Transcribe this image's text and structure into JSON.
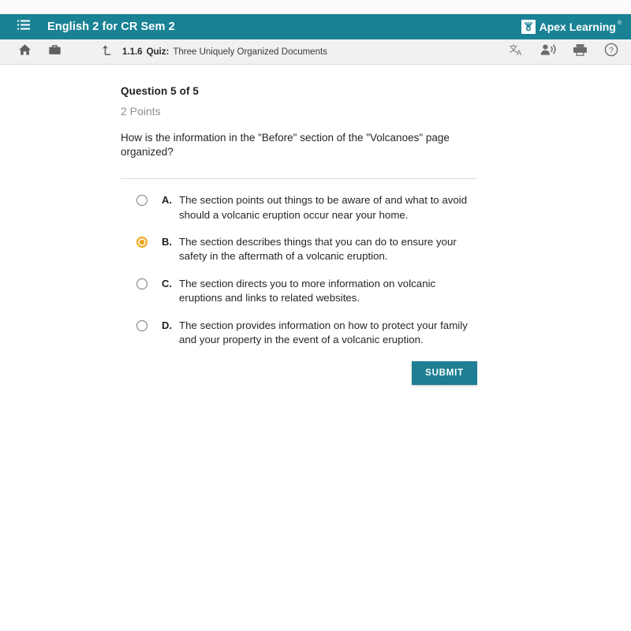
{
  "header": {
    "menu_icon": "list-icon",
    "course_title": "English 2 for CR Sem 2",
    "brand_name": "Apex Learning",
    "brand_tm": "®",
    "brand_logo_icon": "apex-sunburst-logo-icon",
    "accent_color": "#1a8295"
  },
  "subbar": {
    "home_icon": "home-icon",
    "briefcase_icon": "briefcase-icon",
    "up_icon": "arrow-up-from-corner-icon",
    "breadcrumb": {
      "number": "1.1.6",
      "type": "Quiz:",
      "name": "Three Uniquely Organized Documents"
    },
    "translate_icon": "translate-icon",
    "read_aloud_icon": "read-aloud-icon",
    "print_icon": "print-icon",
    "help_icon": "help-circle-icon"
  },
  "question": {
    "heading": "Question 5 of 5",
    "points": "2 Points",
    "prompt": "How is the information in the \"Before\" section of the \"Volcanoes\" page organized?"
  },
  "options": [
    {
      "letter": "A.",
      "text": "The section points out things to be aware of and what to avoid should a volcanic eruption occur near your home.",
      "selected": false
    },
    {
      "letter": "B.",
      "text": "The section describes things that you can do to ensure your safety in the aftermath of a volcanic eruption.",
      "selected": true
    },
    {
      "letter": "C.",
      "text": "The section directs you to more information on volcanic eruptions and links to related websites.",
      "selected": false
    },
    {
      "letter": "D.",
      "text": "The section provides information on how to protect your family and your property in the event of a volcanic eruption.",
      "selected": false
    }
  ],
  "submit": {
    "label": "SUBMIT",
    "color": "#1e7f94"
  },
  "selected_radio_color": "#ef9b18"
}
